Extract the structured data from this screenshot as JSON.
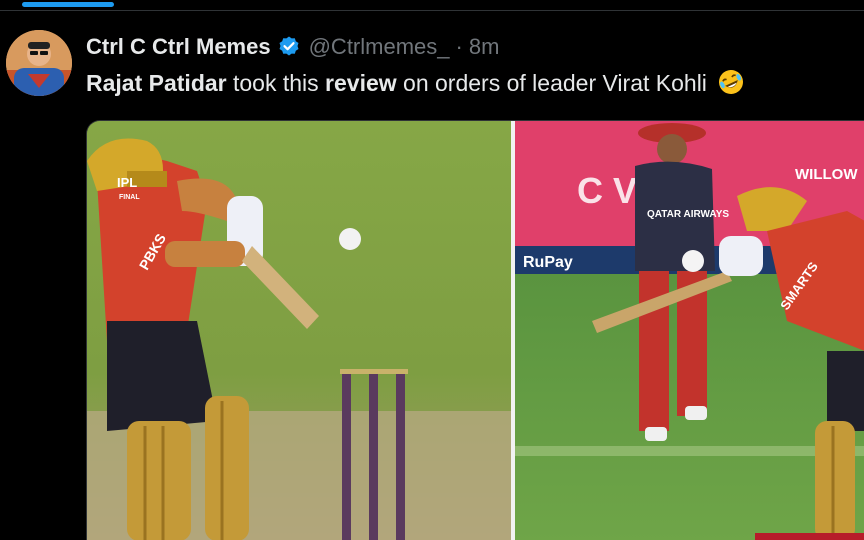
{
  "post": {
    "author_name": "Ctrl C Ctrl Memes",
    "handle": "@Ctrlmemes_",
    "separator": "·",
    "time": "8m",
    "text": {
      "part1": "Rajat Patidar",
      "part2": " took this ",
      "part3": "review",
      "part4": " on orders of leader Virat Kohli"
    },
    "emoji_icon": "rolling-on-floor-laughing-emoji"
  },
  "media": {
    "left_image": {
      "logo_line1": "IPL",
      "logo_line2": "FINAL",
      "jersey_text": "PBKS"
    },
    "right_image": {
      "sponsor_text": "QATAR AIRWAYS",
      "board_brand": "RuPay",
      "broadcaster": "WILLOW",
      "board_letters": "C   V",
      "jersey_text": "SMARTS"
    }
  },
  "colors": {
    "accent": "#1d9bf0",
    "text_primary": "#e7e9ea",
    "text_secondary": "#71767b",
    "background": "#000000"
  }
}
